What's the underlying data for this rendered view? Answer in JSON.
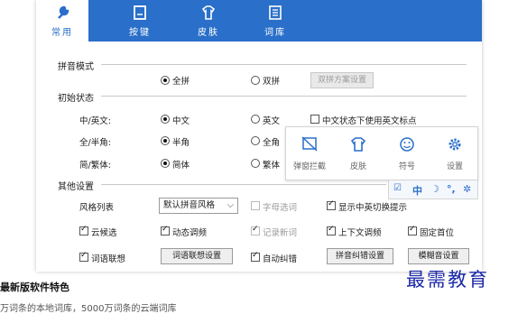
{
  "tabs": [
    {
      "label": "常用",
      "icon": "wrench-icon"
    },
    {
      "label": "按键",
      "icon": "keyboard-icon"
    },
    {
      "label": "皮肤",
      "icon": "shirt-icon"
    },
    {
      "label": "词库",
      "icon": "book-icon"
    }
  ],
  "pinyin_mode": {
    "title": "拼音模式",
    "full": "全拼",
    "double": "双拼",
    "double_settings": "双拼方案设置"
  },
  "initial_state": {
    "title": "初始状态",
    "cn_en_label": "中/英文:",
    "cn": "中文",
    "en": "英文",
    "cn_punct": "中文状态下使用英文标点",
    "width_label": "全/半角:",
    "half": "半角",
    "full": "全角",
    "script_label": "简/繁体:",
    "simplified": "简体",
    "traditional": "繁体"
  },
  "other_settings": {
    "title": "其他设置",
    "candidate_style_label": "风格列表",
    "candidate_style_value": "默认拼音风格",
    "char_select": "字母选词",
    "show_cn_en_switch": "显示中英切换提示",
    "cloud_candidate": "云候选",
    "dynamic_freq": "动态调频",
    "record_new_words": "记录新词",
    "context_freq": "上下文调频",
    "fixed_first": "固定首位",
    "word_assoc": "词语联想",
    "word_assoc_settings": "词语联想设置",
    "auto_correct": "自动纠错",
    "pinyin_correct_settings": "拼音纠错设置",
    "fuzzy_settings": "模糊音设置"
  },
  "popup": {
    "items": [
      {
        "label": "弹窗拦截",
        "icon": "block-popup-icon"
      },
      {
        "label": "皮肤",
        "icon": "shirt-icon"
      },
      {
        "label": "符号",
        "icon": "smiley-icon"
      },
      {
        "label": "设置",
        "icon": "gear-icon"
      }
    ],
    "mini_bar": {
      "zh": "中"
    }
  },
  "feature_heading": "最新版软件特色",
  "bottom_text": "万词条的本地词库，5000万词条的云端词库",
  "watermark": "最需教育",
  "colors": {
    "accent": "#2a6fc9",
    "watermark": "#1c2aa8"
  }
}
